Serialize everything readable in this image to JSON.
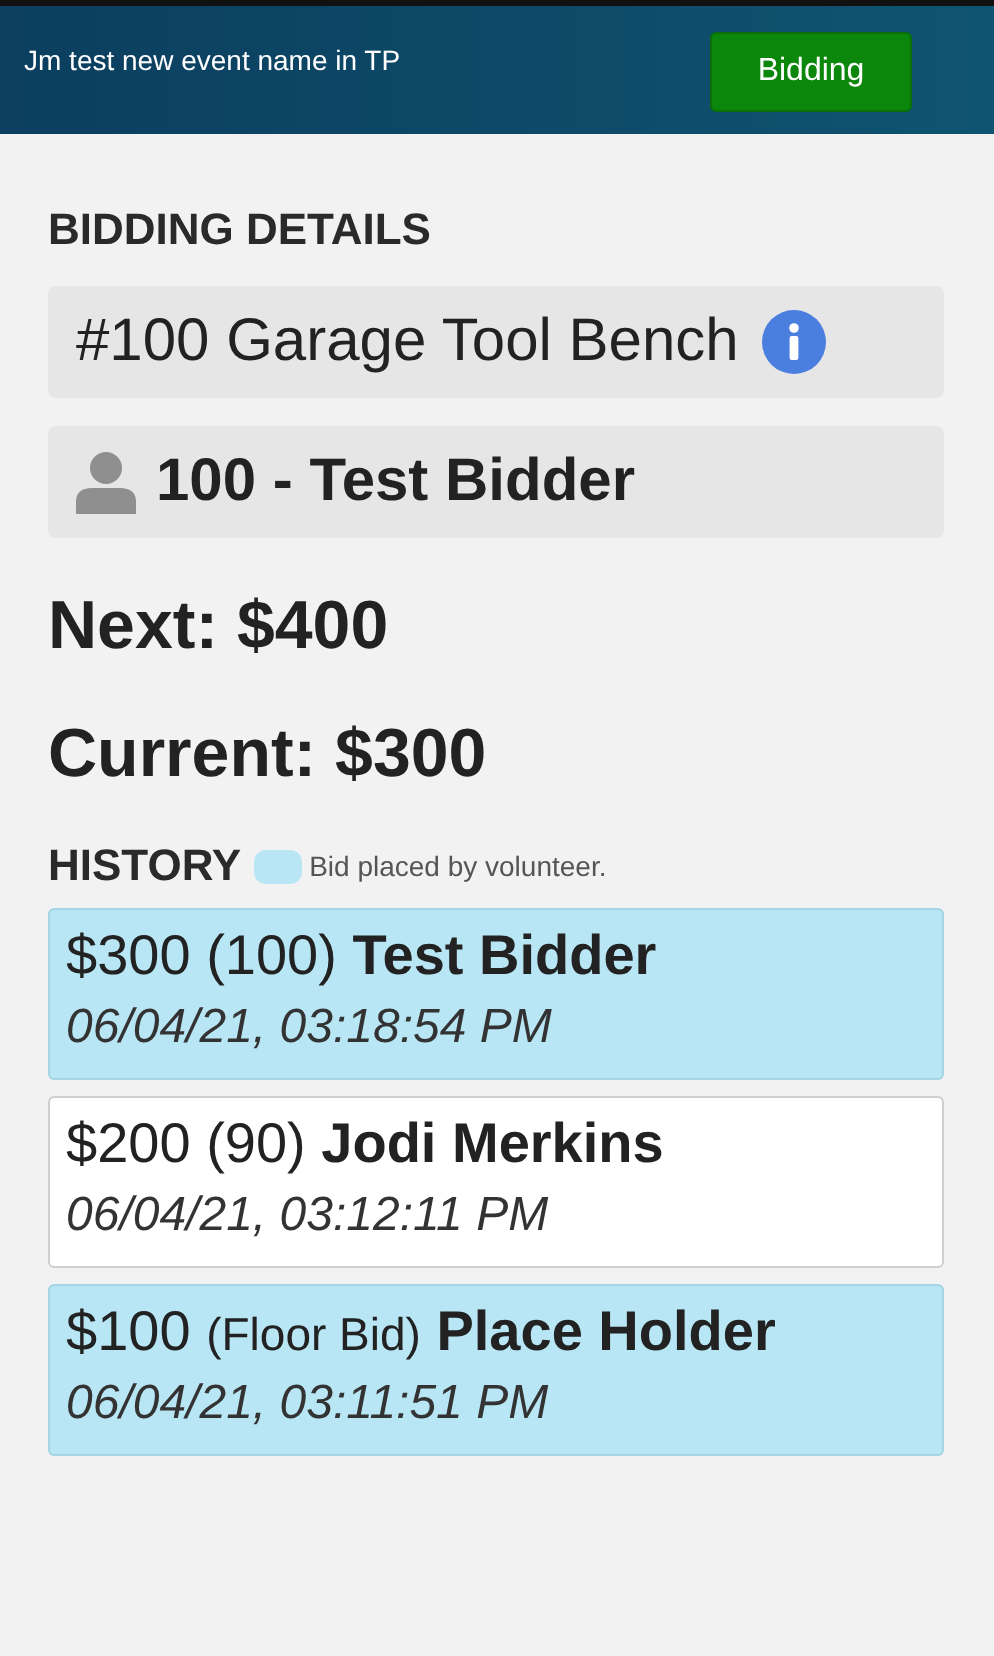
{
  "header": {
    "title": "Jm test new event name in TP",
    "button": "Bidding"
  },
  "details": {
    "heading": "BIDDING DETAILS",
    "item": "#100 Garage Tool Bench",
    "bidder": "100 - Test Bidder"
  },
  "next": "Next: $400",
  "current": "Current: $300",
  "history": {
    "heading": "HISTORY",
    "legend": "Bid placed by volunteer.",
    "bids": [
      {
        "amount": "$300",
        "paddle": "(100)",
        "kind": "paddle",
        "name": "Test Bidder",
        "time": "06/04/21, 03:18:54 PM",
        "volunteer": true
      },
      {
        "amount": "$200",
        "paddle": "(90)",
        "kind": "paddle",
        "name": "Jodi Merkins",
        "time": "06/04/21, 03:12:11 PM",
        "volunteer": false
      },
      {
        "amount": "$100",
        "paddle": "(Floor Bid)",
        "kind": "floor",
        "name": "Place Holder",
        "time": "06/04/21, 03:11:51 PM",
        "volunteer": true
      }
    ]
  }
}
